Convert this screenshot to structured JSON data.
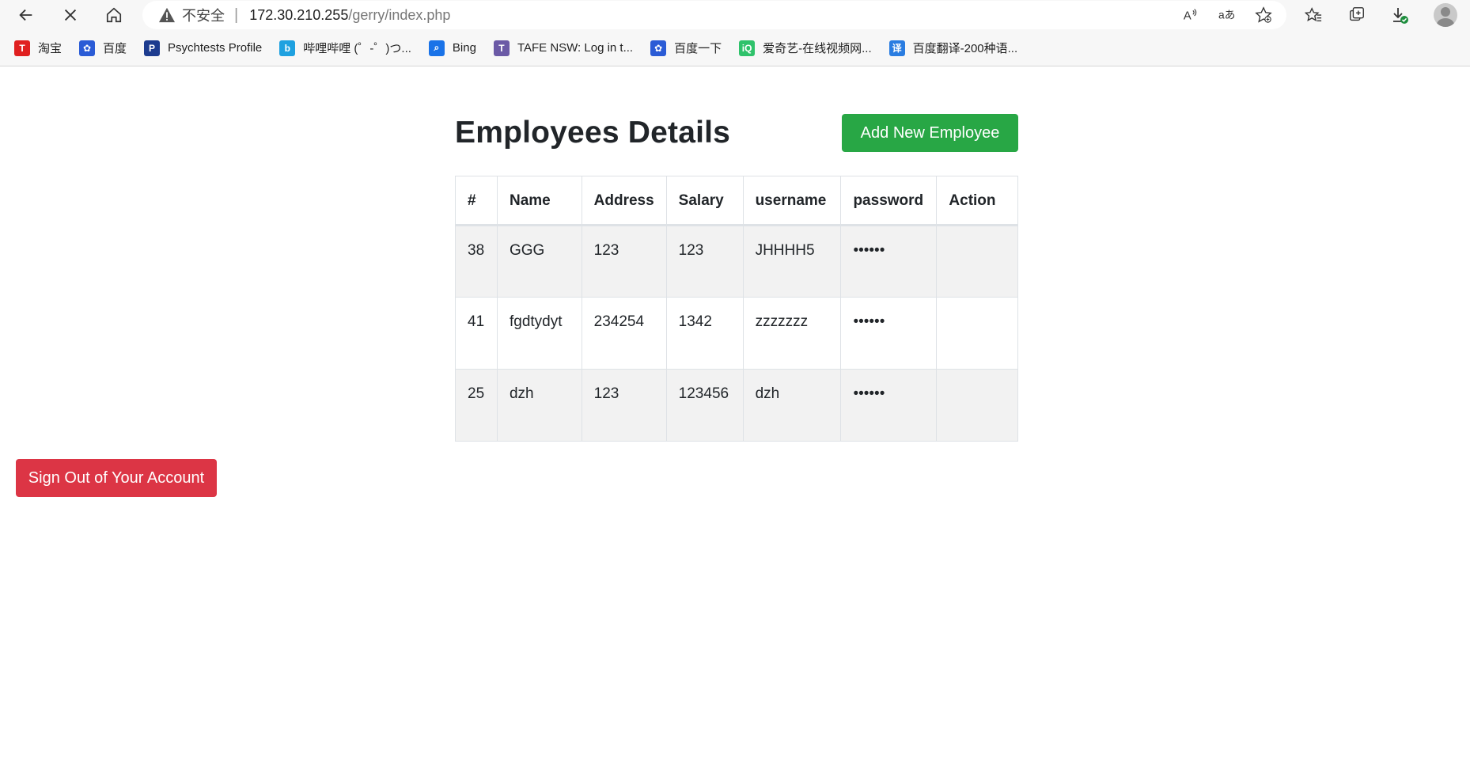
{
  "browser": {
    "insecure_label": "不安全",
    "url_host": "172.30.210.255",
    "url_path": "/gerry/index.php",
    "bookmarks": [
      {
        "label": "淘宝",
        "icon": "taobao-icon",
        "color": "#e02020",
        "glyph": "T"
      },
      {
        "label": "百度",
        "icon": "baidu-paw-icon",
        "color": "#2b5cd6",
        "glyph": "✿"
      },
      {
        "label": "Psychtests Profile",
        "icon": "psychtests-icon",
        "color": "#1d3c8f",
        "glyph": "P"
      },
      {
        "label": "哔哩哔哩 (゜-゜)つ...",
        "icon": "bilibili-icon",
        "color": "#1fa1e0",
        "glyph": "b"
      },
      {
        "label": "Bing",
        "icon": "bing-search-icon",
        "color": "#1a73e8",
        "glyph": "⌕"
      },
      {
        "label": "TAFE NSW: Log in t...",
        "icon": "tafe-icon",
        "color": "#6b5aa6",
        "glyph": "T"
      },
      {
        "label": "百度一下",
        "icon": "baidu-paw-icon",
        "color": "#2b5cd6",
        "glyph": "✿"
      },
      {
        "label": "爱奇艺-在线视频网...",
        "icon": "iqiyi-icon",
        "color": "#2fc26b",
        "glyph": "iQ"
      },
      {
        "label": "百度翻译-200种语...",
        "icon": "baidu-translate-icon",
        "color": "#2a7de1",
        "glyph": "译"
      }
    ]
  },
  "page": {
    "title": "Employees Details",
    "add_button": "Add New Employee",
    "signout_button": "Sign Out of Your Account",
    "accent_green": "#28a745",
    "accent_red": "#dc3545"
  },
  "table": {
    "headers": [
      "#",
      "Name",
      "Address",
      "Salary",
      "username",
      "password",
      "Action"
    ],
    "rows": [
      {
        "id": "38",
        "name": "GGG",
        "address": "123",
        "salary": "123",
        "username": "JHHHH5",
        "password": "••••••",
        "action": ""
      },
      {
        "id": "41",
        "name": "fgdtydyt",
        "address": "234254",
        "salary": "1342",
        "username": "zzzzzzz",
        "password": "••••••",
        "action": ""
      },
      {
        "id": "25",
        "name": "dzh",
        "address": "123",
        "salary": "123456",
        "username": "dzh",
        "password": "••••••",
        "action": ""
      }
    ]
  }
}
